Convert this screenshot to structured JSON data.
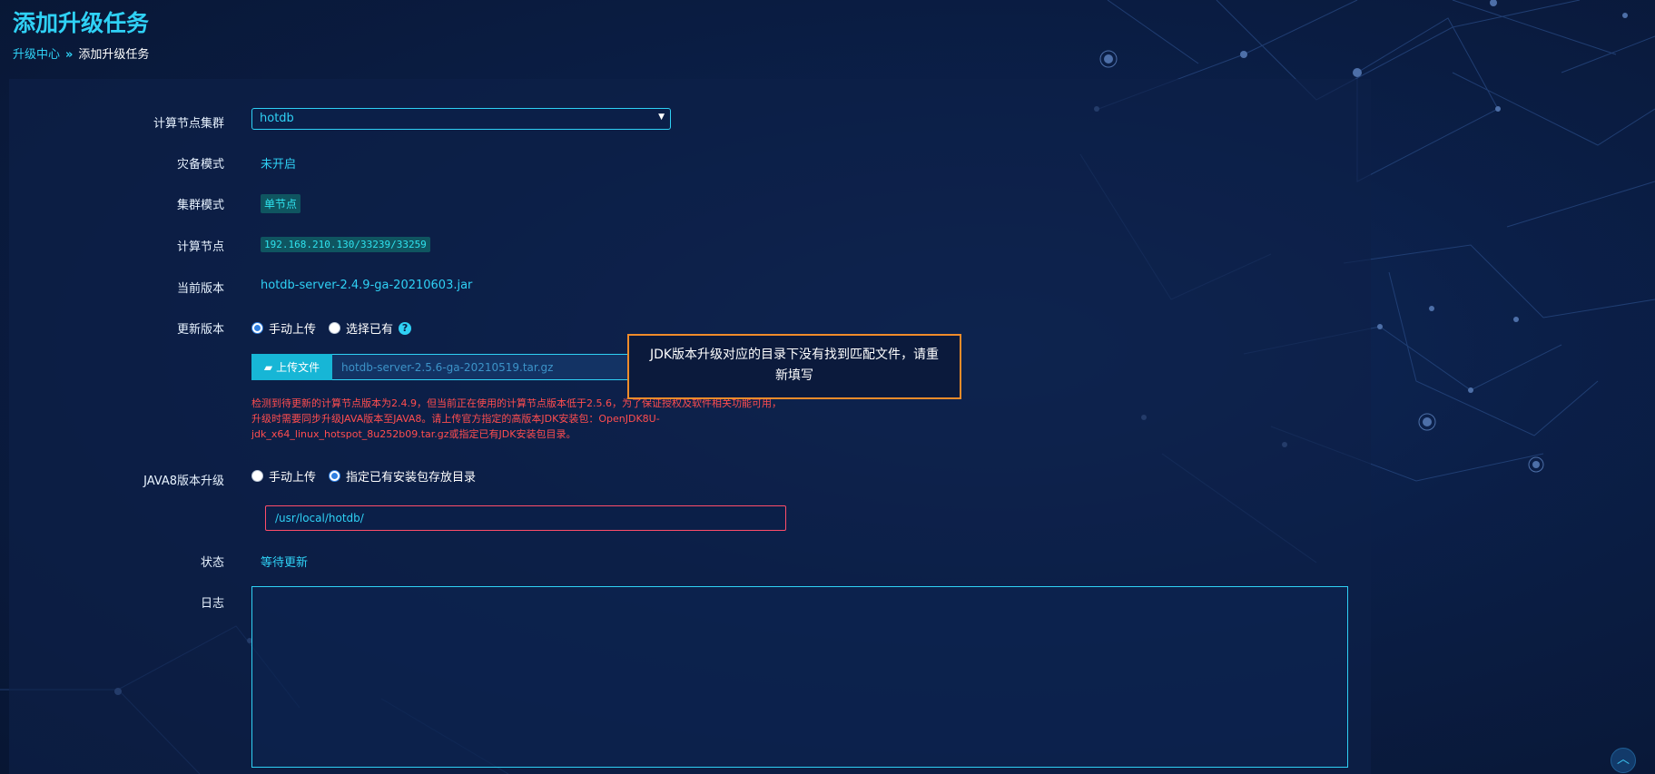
{
  "page": {
    "title": "添加升级任务",
    "breadcrumb": {
      "parent": "升级中心",
      "separator": "»",
      "current": "添加升级任务"
    }
  },
  "form": {
    "cluster": {
      "label": "计算节点集群",
      "value": "hotdb"
    },
    "disaster_mode": {
      "label": "灾备模式",
      "value": "未开启"
    },
    "cluster_mode": {
      "label": "集群模式",
      "value": "单节点"
    },
    "compute_node": {
      "label": "计算节点",
      "value": "192.168.210.130/33239/33259"
    },
    "current_version": {
      "label": "当前版本",
      "value": "hotdb-server-2.4.9-ga-20210603.jar"
    },
    "update_version": {
      "label": "更新版本",
      "options": [
        {
          "label": "手动上传",
          "selected": true
        },
        {
          "label": "选择已有",
          "selected": false
        }
      ],
      "help": "?",
      "upload_button": "上传文件",
      "file_name": "hotdb-server-2.5.6-ga-20210519.tar.gz",
      "warning": "检测到待更新的计算节点版本为2.4.9，但当前正在使用的计算节点版本低于2.5.6，为了保证授权及软件相关功能可用，升级时需要同步升级JAVA版本至JAVA8。请上传官方指定的高版本JDK安装包：OpenJDK8U-jdk_x64_linux_hotspot_8u252b09.tar.gz或指定已有JDK安装包目录。"
    },
    "java8_upgrade": {
      "label": "JAVA8版本升级",
      "options": [
        {
          "label": "手动上传",
          "selected": false
        },
        {
          "label": "指定已有安装包存放目录",
          "selected": true
        }
      ],
      "path": "/usr/local/hotdb/"
    },
    "status": {
      "label": "状态",
      "value": "等待更新"
    },
    "log": {
      "label": "日志",
      "value": ""
    }
  },
  "tooltip": {
    "text": "JDK版本升级对应的目录下没有找到匹配文件，请重新填写"
  },
  "icons": {
    "dropdown": "caret-down-icon",
    "upload": "folder-open-icon",
    "help": "help-icon",
    "back_to_top": "chevron-up-icon"
  },
  "colors": {
    "accent": "#2fd1f5",
    "error": "#ff4d4f",
    "tooltip_border": "#f08c2a",
    "background": "#0a1a3a"
  }
}
